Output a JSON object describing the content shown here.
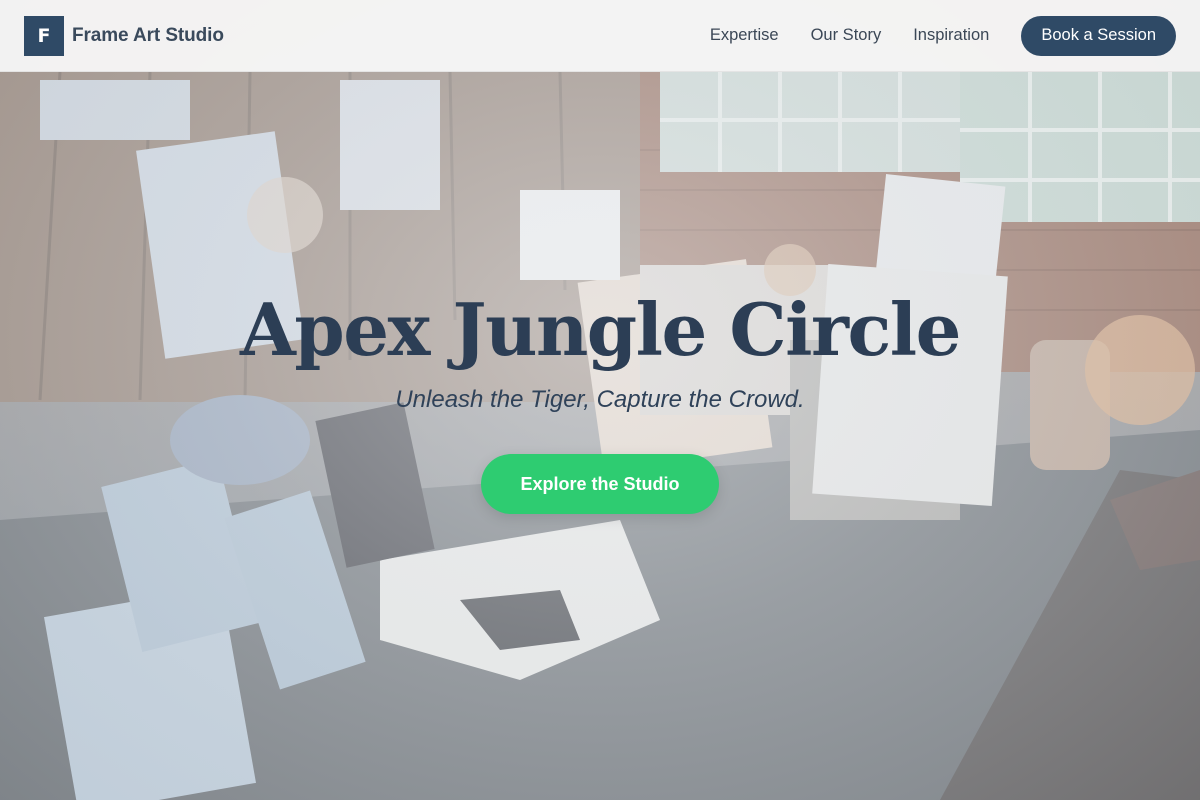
{
  "header": {
    "brand_mark": "F",
    "brand_name": "Frame Art Studio",
    "nav": [
      {
        "label": "Expertise"
      },
      {
        "label": "Our Story"
      },
      {
        "label": "Inspiration"
      }
    ],
    "cta_label": "Book a Session"
  },
  "hero": {
    "title": "Apex Jungle Circle",
    "subtitle": "Unleash the Tiger, Capture the Crowd.",
    "cta_label": "Explore the Studio",
    "background_image": "art studio interior with canvases, chandeliers and paint-splattered floor"
  },
  "colors": {
    "brand": "#2f4a66",
    "title": "#2c3e55",
    "cta_green": "#2ecc71",
    "header_bg": "#f6f6f6"
  }
}
